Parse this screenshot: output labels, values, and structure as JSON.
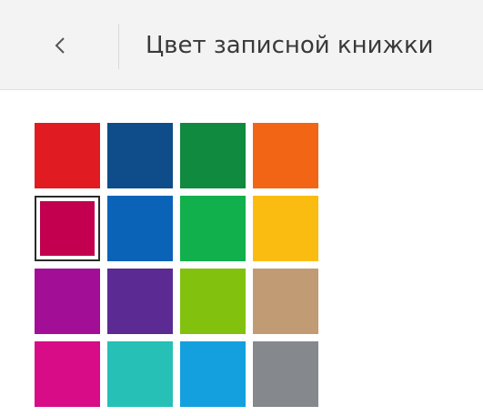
{
  "header": {
    "title": "Цвет записной книжки",
    "back_icon": "chevron-left-icon"
  },
  "palette": {
    "selected_index": 4,
    "colors": [
      "#e11b22",
      "#0f4c8a",
      "#0f8a3e",
      "#f26514",
      "#c2004f",
      "#0b63b8",
      "#12b04c",
      "#fbbc12",
      "#a30e96",
      "#5b2a92",
      "#82c20f",
      "#c19b73",
      "#d80c86",
      "#26c0b6",
      "#14a0de",
      "#85898d"
    ]
  }
}
